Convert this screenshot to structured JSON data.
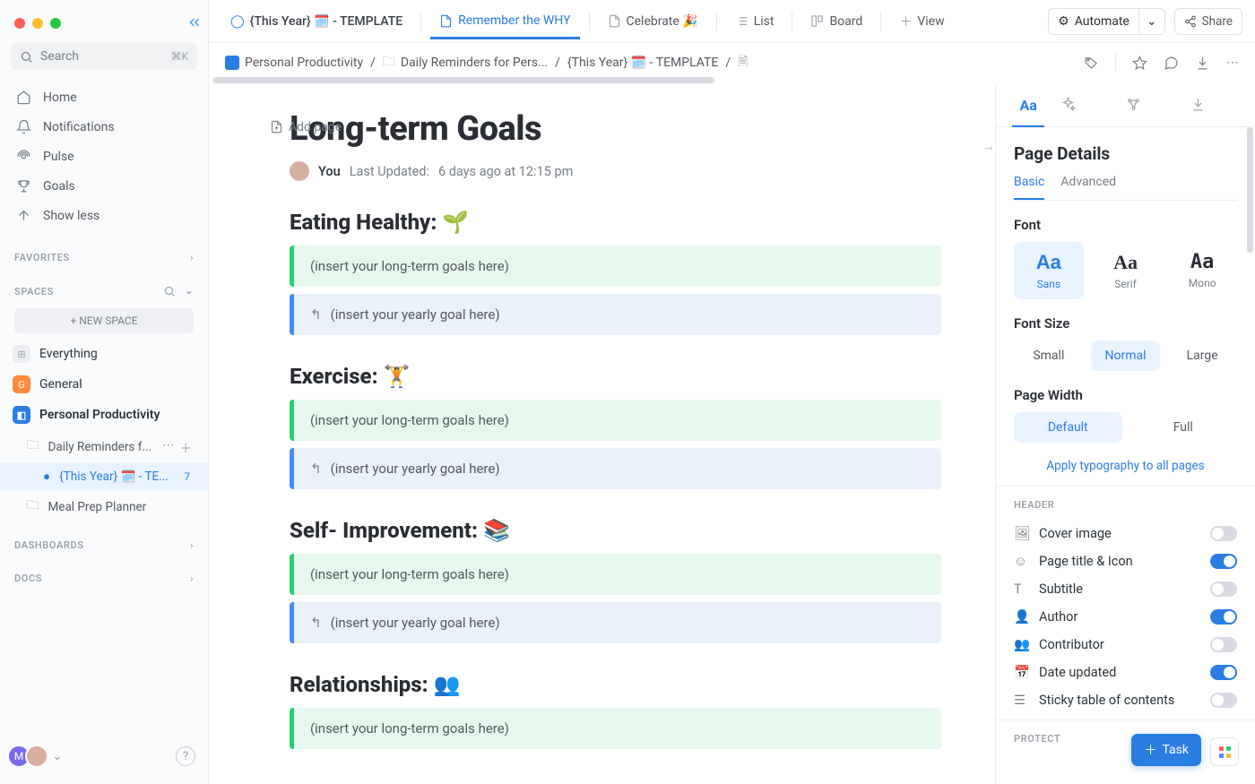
{
  "sidebar": {
    "search_placeholder": "Search",
    "search_shortcut": "⌘K",
    "nav": [
      {
        "icon": "home",
        "label": "Home"
      },
      {
        "icon": "bell",
        "label": "Notifications"
      },
      {
        "icon": "pulse",
        "label": "Pulse"
      },
      {
        "icon": "trophy",
        "label": "Goals"
      },
      {
        "icon": "up",
        "label": "Show less"
      }
    ],
    "favorites_label": "FAVORITES",
    "spaces_label": "SPACES",
    "new_space": "+ NEW SPACE",
    "spaces": {
      "everything": "Everything",
      "general": "General",
      "personal": "Personal Productivity",
      "daily": "Daily Reminders f...",
      "this_year": "{This Year} 🗓️ - TE...",
      "this_year_count": "7",
      "meal": "Meal Prep Planner"
    },
    "dashboards": "DASHBOARDS",
    "docs": "DOCS"
  },
  "topbar": {
    "doc_title": "{This Year} 🗓️ - TEMPLATE",
    "tabs": [
      {
        "label": "Remember the WHY",
        "icon": "doc",
        "active": true
      },
      {
        "label": "Celebrate 🎉",
        "icon": "doc"
      },
      {
        "label": "List",
        "icon": "list"
      },
      {
        "label": "Board",
        "icon": "board"
      },
      {
        "label": "View",
        "icon": "plus"
      }
    ],
    "automate": "Automate",
    "share": "Share"
  },
  "breadcrumbs": [
    {
      "icon": "space",
      "label": "Personal Productivity"
    },
    {
      "icon": "folder",
      "label": "Daily Reminders for Pers..."
    },
    {
      "icon": "",
      "label": "{This Year} 🗓️ - TEMPLATE"
    },
    {
      "icon": "doc",
      "label": ""
    }
  ],
  "add_page": "Add page",
  "doc": {
    "title": "Long-term Goals",
    "author": "You",
    "updated_prefix": "Last Updated:",
    "updated": "6 days ago at 12:15 pm",
    "sections": [
      {
        "title": "Eating Healthy: 🌱",
        "long": "(insert your long-term goals here)",
        "year": "(insert your yearly goal here)"
      },
      {
        "title": "Exercise: 🏋️",
        "long": "(insert your long-term goals here)",
        "year": "(insert your yearly goal here)"
      },
      {
        "title": "Self- Improvement: 📚",
        "long": "(insert your long-term goals here)",
        "year": "(insert your yearly goal here)"
      },
      {
        "title": "Relationships: 👥",
        "long": "(insert your long-term goals here)",
        "year": ""
      }
    ]
  },
  "panel": {
    "title": "Page Details",
    "subtabs": {
      "basic": "Basic",
      "advanced": "Advanced"
    },
    "font_label": "Font",
    "fonts": {
      "sans": "Sans",
      "serif": "Serif",
      "mono": "Mono"
    },
    "size_label": "Font Size",
    "sizes": {
      "small": "Small",
      "normal": "Normal",
      "large": "Large"
    },
    "width_label": "Page Width",
    "widths": {
      "default": "Default",
      "full": "Full"
    },
    "apply": "Apply typography to all pages",
    "header_label": "HEADER",
    "toggles": [
      {
        "icon": "image",
        "label": "Cover image",
        "on": false
      },
      {
        "icon": "smile",
        "label": "Page title & Icon",
        "on": true
      },
      {
        "icon": "subtitle",
        "label": "Subtitle",
        "on": false
      },
      {
        "icon": "person",
        "label": "Author",
        "on": true
      },
      {
        "icon": "people",
        "label": "Contributor",
        "on": false
      },
      {
        "icon": "calendar",
        "label": "Date updated",
        "on": true
      },
      {
        "icon": "toc",
        "label": "Sticky table of contents",
        "on": false
      }
    ],
    "protect_label": "PROTECT"
  },
  "float_task": "Task"
}
